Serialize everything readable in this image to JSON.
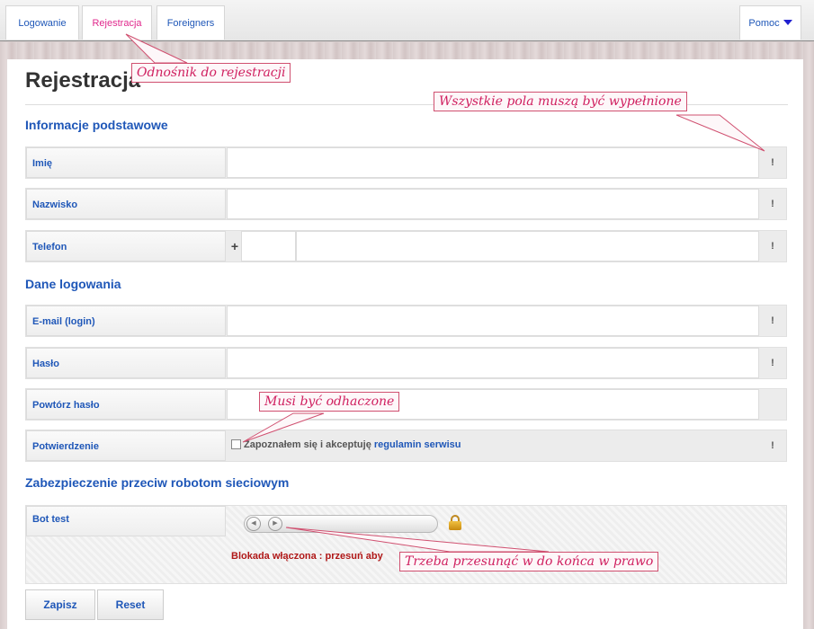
{
  "nav": {
    "tabs": [
      {
        "label": "Logowanie",
        "active": false
      },
      {
        "label": "Rejestracja",
        "active": true
      },
      {
        "label": "Foreigners",
        "active": false
      }
    ],
    "help_label": "Pomoc"
  },
  "page": {
    "title": "Rejestracja"
  },
  "sections": {
    "basic": "Informacje podstawowe",
    "login": "Dane logowania",
    "bot": "Zabezpieczenie przeciw robotom sieciowym"
  },
  "fields": {
    "first_name": {
      "label": "Imię",
      "value": "",
      "required_mark": "!"
    },
    "last_name": {
      "label": "Nazwisko",
      "value": "",
      "required_mark": "!"
    },
    "phone": {
      "label": "Telefon",
      "prefix_symbol": "+",
      "prefix_value": "",
      "value": "",
      "required_mark": "!"
    },
    "email": {
      "label": "E-mail (login)",
      "value": "",
      "required_mark": "!"
    },
    "password": {
      "label": "Hasło",
      "value": "",
      "required_mark": "!"
    },
    "password_repeat": {
      "label": "Powtórz hasło",
      "value": ""
    },
    "confirmation": {
      "label": "Potwierdzenie",
      "checkbox_text": "Zapoznałem się i akceptuję",
      "link_text": "regulamin serwisu",
      "checked": false,
      "required_mark": "!"
    }
  },
  "bot_test": {
    "label": "Bot test",
    "status_text": "Blokada włączona : przesuń aby",
    "slider_position": 0,
    "locked": true
  },
  "buttons": {
    "save": "Zapisz",
    "reset": "Reset"
  },
  "annotations": {
    "registration_link": "Odnośnik do rejestracji",
    "all_required": "Wszystkie pola muszą być wypełnione",
    "must_uncheck": "Musi być odhaczone",
    "slide_right": "Trzeba przesunąć w do końca w prawo",
    "color": "#d02060"
  },
  "colors": {
    "link_blue": "#1f57b8",
    "active_tab": "#e0288c",
    "status_red": "#b01818"
  }
}
